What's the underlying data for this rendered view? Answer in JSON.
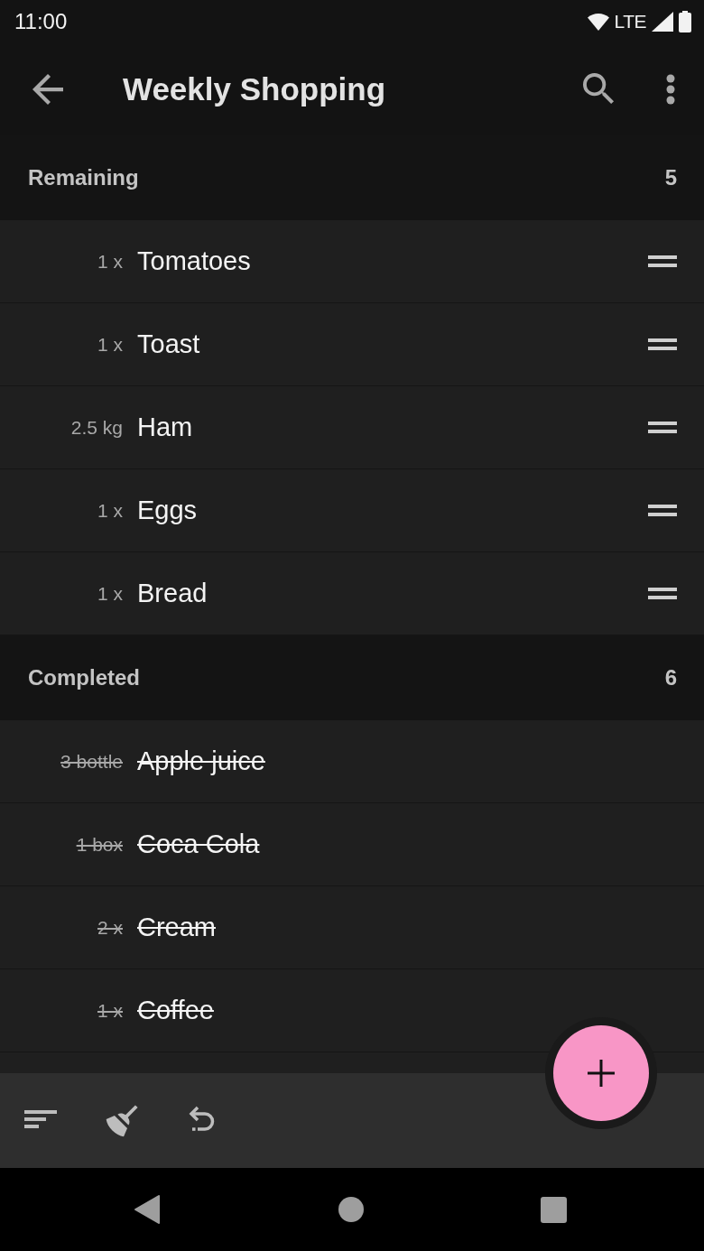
{
  "status_bar": {
    "time": "11:00",
    "network": "LTE"
  },
  "app_bar": {
    "title": "Weekly Shopping"
  },
  "sections": [
    {
      "title": "Remaining",
      "count": "5",
      "items": [
        {
          "quantity": "1 x",
          "name": "Tomatoes",
          "completed": false
        },
        {
          "quantity": "1 x",
          "name": "Toast",
          "completed": false
        },
        {
          "quantity": "2.5 kg",
          "name": "Ham",
          "completed": false
        },
        {
          "quantity": "1 x",
          "name": "Eggs",
          "completed": false
        },
        {
          "quantity": "1 x",
          "name": "Bread",
          "completed": false
        }
      ]
    },
    {
      "title": "Completed",
      "count": "6",
      "items": [
        {
          "quantity": "3 bottle",
          "name": "Apple juice",
          "completed": true
        },
        {
          "quantity": "1 box",
          "name": "Coca Cola",
          "completed": true
        },
        {
          "quantity": "2 x",
          "name": "Cream",
          "completed": true
        },
        {
          "quantity": "1 x",
          "name": "Coffee",
          "completed": true
        }
      ]
    }
  ]
}
